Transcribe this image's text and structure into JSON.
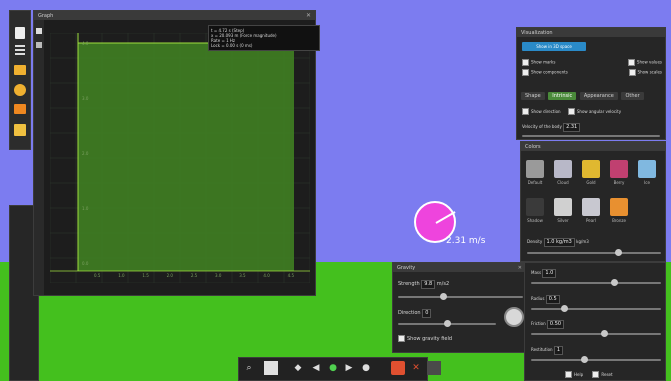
{
  "graph": {
    "title": "Graph",
    "readout_lines": [
      "t = 4.72 s (Step)",
      "x = 20.093 m (Force magnitude)",
      "Rate = 1 Hz",
      "Lock = 0.00 s (0 ms)"
    ],
    "y_ticks": [
      "4.0",
      "3.0",
      "2.0",
      "1.0",
      "0.0"
    ],
    "x_ticks": [
      "0.5",
      "1.0",
      "1.5",
      "2.0",
      "2.5",
      "3.0",
      "3.5",
      "4.0",
      "4.5"
    ]
  },
  "scene": {
    "velocity_label": "2.31 m/s",
    "ball_color": "#ee44dd"
  },
  "right_panel": {
    "title": "Visualization",
    "primary_button": "Show in 3D space",
    "checkboxes": [
      "Show marks",
      "Show values",
      "Show components",
      "Show scales"
    ],
    "tabs": [
      "Shape",
      "Intrinsic",
      "Appearance",
      "Other"
    ],
    "tab_options": [
      "Show direction",
      "Show angular velocity"
    ],
    "velocity_label": "Velocity of the body",
    "velocity_value": "2.31"
  },
  "palette_panel": {
    "title": "Colors",
    "swatches": [
      {
        "label": "Default",
        "color": "#9a9a9a"
      },
      {
        "label": "Cloud",
        "color": "#b8b8c8"
      },
      {
        "label": "Gold",
        "color": "#e0b830"
      },
      {
        "label": "Berry",
        "color": "#c04070"
      },
      {
        "label": "Ice",
        "color": "#80b8e0"
      },
      {
        "label": "Shadow",
        "color": "#3a3a3a"
      },
      {
        "label": "Silver",
        "color": "#d0d0d0"
      },
      {
        "label": "Pearl",
        "color": "#c8c8d0"
      },
      {
        "label": "Bronze",
        "color": "#e89030"
      }
    ],
    "density_label": "Density",
    "density_value": "1.0 kg/m3",
    "density_unit": "kg/m3"
  },
  "gravity_panel": {
    "title": "Gravity",
    "strength_label": "Strength",
    "strength_value": "9.8",
    "strength_unit": "m/s2",
    "direction_label": "Direction",
    "direction_value": "0",
    "checkbox_label": "Show gravity field"
  },
  "lower_right": {
    "rows": [
      {
        "label": "Mass",
        "value": "1.0"
      },
      {
        "label": "Radius",
        "value": "0.5"
      },
      {
        "label": "Friction",
        "value": "0.50"
      },
      {
        "label": "Restitution",
        "value": "1"
      }
    ],
    "footer": [
      "Help",
      "Reset"
    ]
  },
  "left_toolbar": {
    "tools": [
      "new-file-icon",
      "tools-icon",
      "folder-icon",
      "gear-icon",
      "open-folder-icon",
      "save-icon"
    ]
  },
  "bottom_toolbar": {
    "buttons": [
      "zoom-icon",
      "grid-icon",
      "play-icon",
      "undo-icon",
      "step-icon",
      "redo-icon",
      "settings-icon",
      "camera-icon",
      "tree-icon",
      "chart-icon"
    ]
  }
}
